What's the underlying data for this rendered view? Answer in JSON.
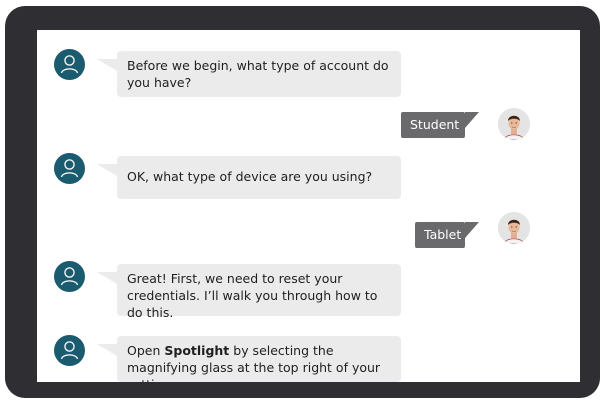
{
  "conversation": {
    "messages": [
      {
        "sender": "bot",
        "text": "Before we begin, what type of account do you have?"
      },
      {
        "sender": "user",
        "text": "Student"
      },
      {
        "sender": "bot",
        "text": "OK, what type of device are you using?"
      },
      {
        "sender": "user",
        "text": "Tablet"
      },
      {
        "sender": "bot",
        "text": "Great! First, we need to reset your credentials. I’ll walk you through how to do this."
      },
      {
        "sender": "bot",
        "text_before": "Open ",
        "text_bold": "Spotlight",
        "text_after": " by selecting the magnifying glass at the top right of your setting."
      }
    ]
  },
  "colors": {
    "device_frame": "#2f2f33",
    "bot_avatar": "#1b5b6f",
    "bot_bubble": "#ebebeb",
    "user_bubble": "#6a6a6c"
  },
  "icons": {
    "bot_avatar": "person-outline-icon",
    "user_avatar": "user-photo-avatar"
  }
}
